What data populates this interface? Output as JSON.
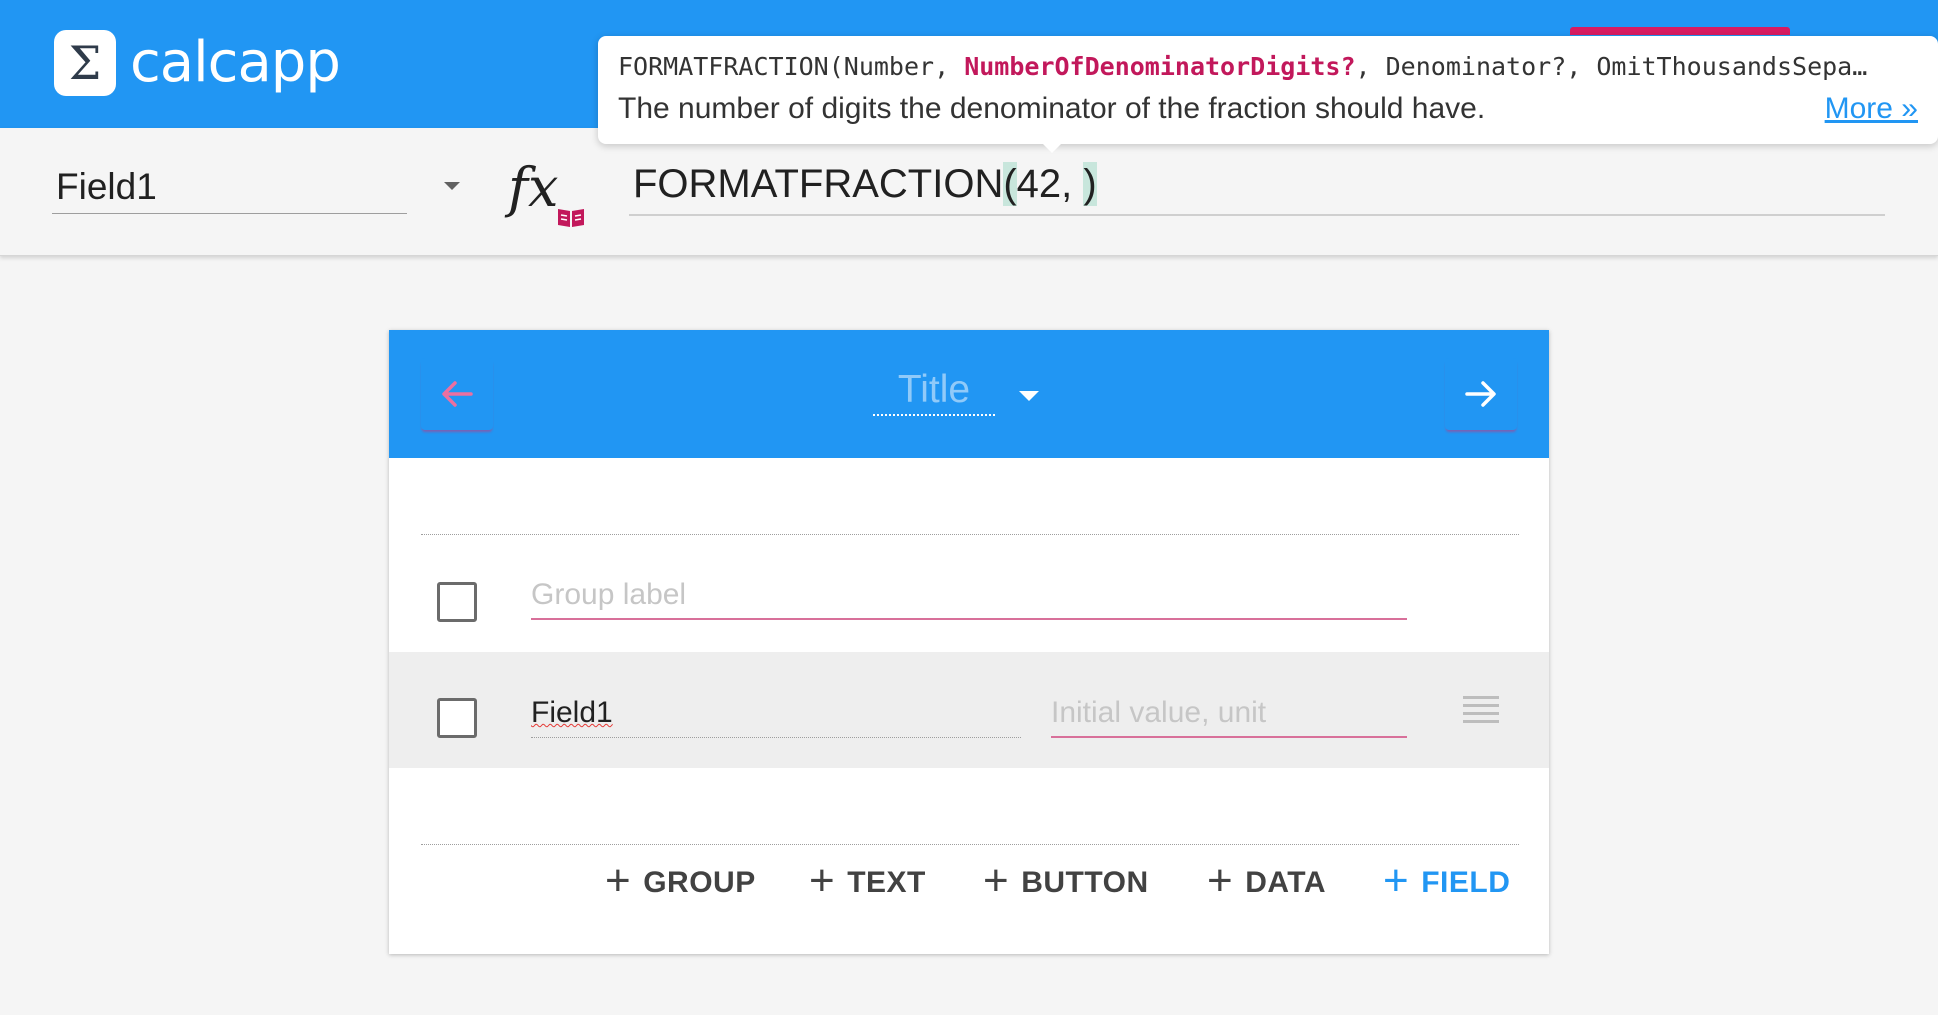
{
  "app": {
    "name": "calcapp",
    "logo_glyph": "Σ",
    "brand_color": "#2196f3",
    "accent_color": "#d81b60"
  },
  "formula_bar": {
    "selected_field": "Field1",
    "fx_glyph": "fx",
    "formula_prefix": "FORMATFRACTION",
    "formula_open": "(",
    "formula_args": "42, ",
    "formula_close": ")"
  },
  "tooltip": {
    "sig_start": "FORMATFRACTION(Number, ",
    "sig_highlight": "NumberOfDenominatorDigits?",
    "sig_end": ", Denominator?, OmitThousandsSepa…",
    "description": "The number of digits the denominator of the fraction should have.",
    "more_link": "More »"
  },
  "screen": {
    "title_placeholder": "Title",
    "group_label_placeholder": "Group label",
    "field_name": "Field1",
    "initial_value_placeholder": "Initial value, unit",
    "add_buttons": [
      {
        "label": "GROUP"
      },
      {
        "label": "TEXT"
      },
      {
        "label": "BUTTON"
      },
      {
        "label": "DATA"
      },
      {
        "label": "FIELD"
      }
    ],
    "plus_glyph": "+"
  }
}
